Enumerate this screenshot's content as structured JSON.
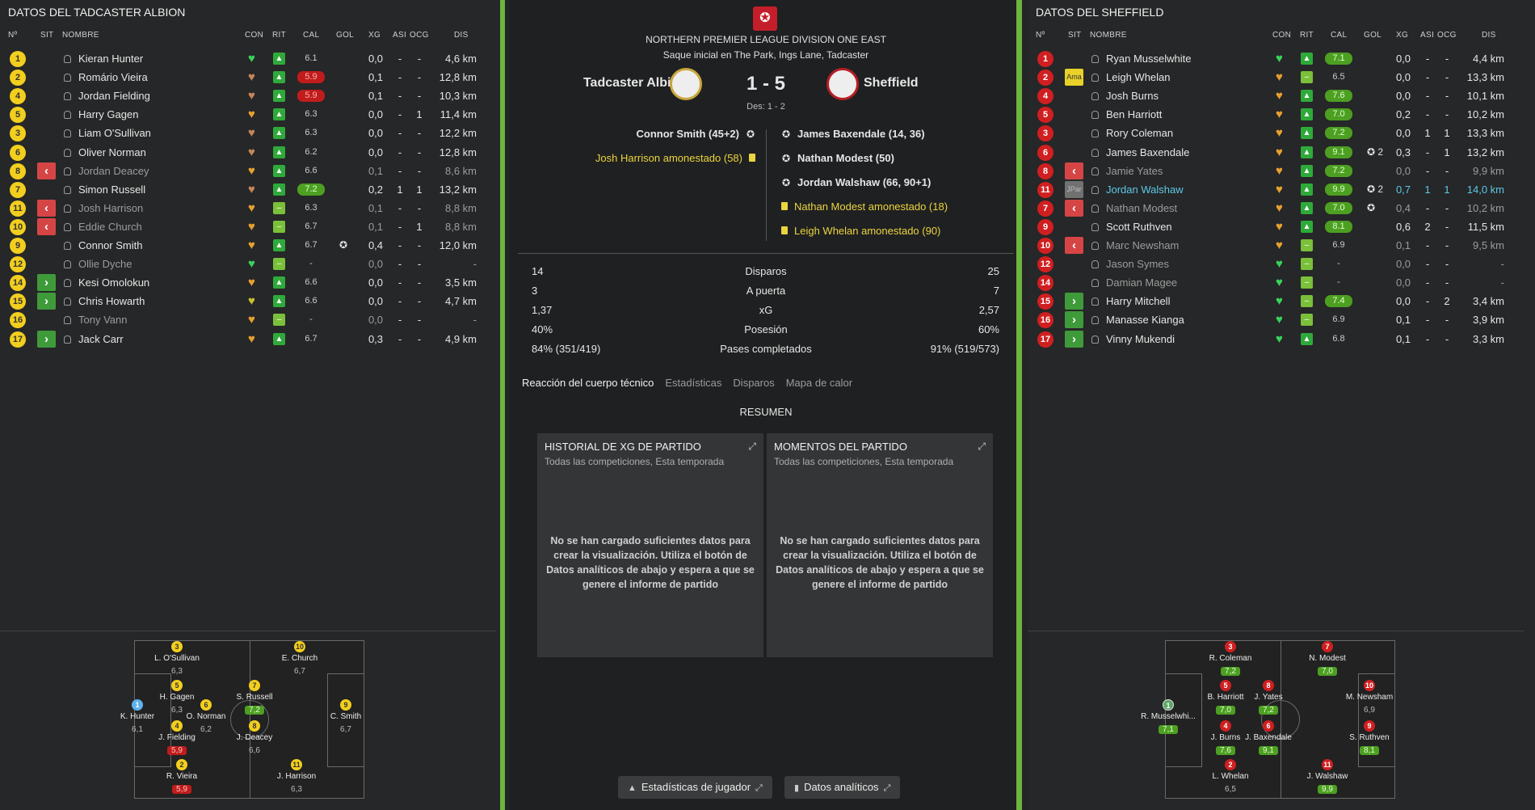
{
  "columns": {
    "num": "Nº",
    "sit": "SIT",
    "nombre": "NOMBRE",
    "con": "CON",
    "rit": "RIT",
    "cal": "CAL",
    "gol": "GOL",
    "xg": "XG",
    "asi": "ASI",
    "ocg": "OCG",
    "dis": "DIS"
  },
  "left": {
    "title": "DATOS DEL TADCASTER ALBION",
    "players": [
      {
        "num": "1",
        "name": "Kieran Hunter",
        "sit": "",
        "cal": "6.1",
        "calc": "",
        "heart": "h-green",
        "rit": "up",
        "goal": "",
        "xg": "0,0",
        "asi": "-",
        "ocg": "-",
        "dis": "4,6 km",
        "dim": false
      },
      {
        "num": "2",
        "name": "Romário Vieira",
        "sit": "",
        "cal": "5.9",
        "calc": "red",
        "heart": "h-brown",
        "rit": "up",
        "goal": "",
        "xg": "0,1",
        "asi": "-",
        "ocg": "-",
        "dis": "12,8 km",
        "dim": false
      },
      {
        "num": "4",
        "name": "Jordan Fielding",
        "sit": "",
        "cal": "5.9",
        "calc": "red",
        "heart": "h-brown",
        "rit": "up",
        "goal": "",
        "xg": "0,1",
        "asi": "-",
        "ocg": "-",
        "dis": "10,3 km",
        "dim": false
      },
      {
        "num": "5",
        "name": "Harry Gagen",
        "sit": "",
        "cal": "6.3",
        "calc": "",
        "heart": "h-orange",
        "rit": "up",
        "goal": "",
        "xg": "0,0",
        "asi": "-",
        "ocg": "1",
        "dis": "11,4 km",
        "dim": false
      },
      {
        "num": "3",
        "name": "Liam O'Sullivan",
        "sit": "",
        "cal": "6.3",
        "calc": "",
        "heart": "h-brown",
        "rit": "up",
        "goal": "",
        "xg": "0,0",
        "asi": "-",
        "ocg": "-",
        "dis": "12,2 km",
        "dim": false
      },
      {
        "num": "6",
        "name": "Oliver Norman",
        "sit": "",
        "cal": "6.2",
        "calc": "",
        "heart": "h-brown",
        "rit": "up",
        "goal": "",
        "xg": "0,0",
        "asi": "-",
        "ocg": "-",
        "dis": "12,8 km",
        "dim": false
      },
      {
        "num": "8",
        "name": "Jordan Deacey",
        "sit": "sub",
        "cal": "6.6",
        "calc": "",
        "heart": "h-orange",
        "rit": "up",
        "goal": "",
        "xg": "0,1",
        "asi": "-",
        "ocg": "-",
        "dis": "8,6 km",
        "dim": true
      },
      {
        "num": "7",
        "name": "Simon Russell",
        "sit": "",
        "cal": "7.2",
        "calc": "green",
        "heart": "h-brown",
        "rit": "up",
        "goal": "",
        "xg": "0,2",
        "asi": "1",
        "ocg": "1",
        "dis": "13,2 km",
        "dim": false
      },
      {
        "num": "11",
        "name": "Josh Harrison",
        "sit": "sub",
        "cal": "6.3",
        "calc": "",
        "heart": "h-orange",
        "rit": "neutral",
        "goal": "",
        "xg": "0,1",
        "asi": "-",
        "ocg": "-",
        "dis": "8,8 km",
        "dim": true
      },
      {
        "num": "10",
        "name": "Eddie Church",
        "sit": "sub",
        "cal": "6.7",
        "calc": "",
        "heart": "h-orange",
        "rit": "neutral",
        "goal": "",
        "xg": "0,1",
        "asi": "-",
        "ocg": "1",
        "dis": "8,8 km",
        "dim": true
      },
      {
        "num": "9",
        "name": "Connor Smith",
        "sit": "",
        "cal": "6.7",
        "calc": "",
        "heart": "h-orange",
        "rit": "up",
        "goal": "✪",
        "xg": "0,4",
        "asi": "-",
        "ocg": "-",
        "dis": "12,0 km",
        "dim": false
      },
      {
        "num": "12",
        "name": "Ollie Dyche",
        "sit": "",
        "cal": "-",
        "calc": "",
        "heart": "h-green",
        "rit": "neutral",
        "goal": "",
        "xg": "0,0",
        "asi": "-",
        "ocg": "-",
        "dis": "-",
        "dim": true
      },
      {
        "num": "14",
        "name": "Kesi Omolokun",
        "sit": "on",
        "cal": "6.6",
        "calc": "",
        "heart": "h-orange",
        "rit": "up",
        "goal": "",
        "xg": "0,0",
        "asi": "-",
        "ocg": "-",
        "dis": "3,5 km",
        "dim": false
      },
      {
        "num": "15",
        "name": "Chris Howarth",
        "sit": "on",
        "cal": "6.6",
        "calc": "",
        "heart": "h-yellowg",
        "rit": "up",
        "goal": "",
        "xg": "0,0",
        "asi": "-",
        "ocg": "-",
        "dis": "4,7 km",
        "dim": false
      },
      {
        "num": "16",
        "name": "Tony Vann",
        "sit": "",
        "cal": "-",
        "calc": "",
        "heart": "h-orange",
        "rit": "neutral",
        "goal": "",
        "xg": "0,0",
        "asi": "-",
        "ocg": "-",
        "dis": "-",
        "dim": true
      },
      {
        "num": "17",
        "name": "Jack Carr",
        "sit": "on",
        "cal": "6.7",
        "calc": "",
        "heart": "h-orange",
        "rit": "up",
        "goal": "",
        "xg": "0,3",
        "asi": "-",
        "ocg": "-",
        "dis": "4,9 km",
        "dim": false
      }
    ]
  },
  "right": {
    "title": "DATOS DEL SHEFFIELD",
    "players": [
      {
        "num": "1",
        "name": "Ryan Musselwhite",
        "sit": "",
        "cal": "7.1",
        "calc": "green",
        "heart": "h-green",
        "rit": "up",
        "goal": "",
        "xg": "0,0",
        "asi": "-",
        "ocg": "-",
        "dis": "4,4 km",
        "dim": false
      },
      {
        "num": "2",
        "name": "Leigh Whelan",
        "sit": "ama",
        "sitlabel": "Ama",
        "cal": "6.5",
        "calc": "",
        "heart": "h-orange",
        "rit": "neutral",
        "goal": "",
        "xg": "0,0",
        "asi": "-",
        "ocg": "-",
        "dis": "13,3 km",
        "dim": false
      },
      {
        "num": "4",
        "name": "Josh Burns",
        "sit": "",
        "cal": "7.6",
        "calc": "green",
        "heart": "h-orange",
        "rit": "up",
        "goal": "",
        "xg": "0,0",
        "asi": "-",
        "ocg": "-",
        "dis": "10,1 km",
        "dim": false
      },
      {
        "num": "5",
        "name": "Ben Harriott",
        "sit": "",
        "cal": "7.0",
        "calc": "green",
        "heart": "h-orange",
        "rit": "up",
        "goal": "",
        "xg": "0,2",
        "asi": "-",
        "ocg": "-",
        "dis": "10,2 km",
        "dim": false
      },
      {
        "num": "3",
        "name": "Rory Coleman",
        "sit": "",
        "cal": "7.2",
        "calc": "green",
        "heart": "h-orange",
        "rit": "up",
        "goal": "",
        "xg": "0,0",
        "asi": "1",
        "ocg": "1",
        "dis": "13,3 km",
        "dim": false
      },
      {
        "num": "6",
        "name": "James Baxendale",
        "sit": "",
        "cal": "9.1",
        "calc": "green",
        "heart": "h-orange",
        "rit": "up",
        "goal": "✪ 2",
        "xg": "0,3",
        "asi": "-",
        "ocg": "1",
        "dis": "13,2 km",
        "dim": false
      },
      {
        "num": "8",
        "name": "Jamie Yates",
        "sit": "sub",
        "cal": "7.2",
        "calc": "green",
        "heart": "h-orange",
        "rit": "up",
        "goal": "",
        "xg": "0,0",
        "asi": "-",
        "ocg": "-",
        "dis": "9,9 km",
        "dim": true
      },
      {
        "num": "11",
        "name": "Jordan Walshaw",
        "sit": "jpar",
        "sitlabel": "JPar",
        "cal": "9.9",
        "calc": "green",
        "heart": "h-orange",
        "rit": "up",
        "goal": "✪ 2",
        "xg": "0,7",
        "asi": "1",
        "ocg": "1",
        "dis": "14,0 km",
        "dim": false,
        "hl": true
      },
      {
        "num": "7",
        "name": "Nathan Modest",
        "sit": "sub",
        "cal": "7.0",
        "calc": "green",
        "heart": "h-orange",
        "rit": "up",
        "goal": "✪",
        "xg": "0,4",
        "asi": "-",
        "ocg": "-",
        "dis": "10,2 km",
        "dim": true
      },
      {
        "num": "9",
        "name": "Scott Ruthven",
        "sit": "",
        "cal": "8.1",
        "calc": "green",
        "heart": "h-orange",
        "rit": "up",
        "goal": "",
        "xg": "0,6",
        "asi": "2",
        "ocg": "-",
        "dis": "11,5 km",
        "dim": false
      },
      {
        "num": "10",
        "name": "Marc Newsham",
        "sit": "sub",
        "cal": "6.9",
        "calc": "",
        "heart": "h-orange",
        "rit": "neutral",
        "goal": "",
        "xg": "0,1",
        "asi": "-",
        "ocg": "-",
        "dis": "9,5 km",
        "dim": true
      },
      {
        "num": "12",
        "name": "Jason Symes",
        "sit": "",
        "cal": "-",
        "calc": "",
        "heart": "h-green",
        "rit": "neutral",
        "goal": "",
        "xg": "0,0",
        "asi": "-",
        "ocg": "-",
        "dis": "-",
        "dim": true
      },
      {
        "num": "14",
        "name": "Damian Magee",
        "sit": "",
        "cal": "-",
        "calc": "",
        "heart": "h-green",
        "rit": "neutral",
        "goal": "",
        "xg": "0,0",
        "asi": "-",
        "ocg": "-",
        "dis": "-",
        "dim": true
      },
      {
        "num": "15",
        "name": "Harry Mitchell",
        "sit": "on",
        "cal": "7.4",
        "calc": "green",
        "heart": "h-green",
        "rit": "neutral",
        "goal": "",
        "xg": "0,0",
        "asi": "-",
        "ocg": "2",
        "dis": "3,4 km",
        "dim": false
      },
      {
        "num": "16",
        "name": "Manasse Kianga",
        "sit": "on",
        "cal": "6.9",
        "calc": "",
        "heart": "h-green",
        "rit": "neutral",
        "goal": "",
        "xg": "0,1",
        "asi": "-",
        "ocg": "-",
        "dis": "3,9 km",
        "dim": false
      },
      {
        "num": "17",
        "name": "Vinny Mukendi",
        "sit": "on",
        "cal": "6.8",
        "calc": "",
        "heart": "h-green",
        "rit": "up",
        "goal": "",
        "xg": "0,1",
        "asi": "-",
        "ocg": "-",
        "dis": "3,3 km",
        "dim": false
      }
    ]
  },
  "center": {
    "league": "NORTHERN PREMIER LEAGUE DIVISION ONE EAST",
    "venue": "Saque inicial en The Park, Ings Lane, Tadcaster",
    "home": "Tadcaster Albion",
    "away": "Sheffield",
    "score": "1 - 5",
    "halftime": "Des: 1 - 2",
    "home_events": [
      {
        "text": "Connor Smith (45+2)",
        "type": "goal"
      },
      {
        "text": "Josh Harrison amonestado (58)",
        "type": "card"
      }
    ],
    "away_events": [
      {
        "text": "James Baxendale (14, 36)",
        "type": "goal"
      },
      {
        "text": "Nathan Modest (50)",
        "type": "goal"
      },
      {
        "text": "Jordan Walshaw (66, 90+1)",
        "type": "goal"
      },
      {
        "text": "Nathan Modest amonestado (18)",
        "type": "card"
      },
      {
        "text": "Leigh Whelan amonestado (90)",
        "type": "card"
      }
    ],
    "stats": [
      {
        "label": "Disparos",
        "home": "14",
        "away": "25"
      },
      {
        "label": "A puerta",
        "home": "3",
        "away": "7"
      },
      {
        "label": "xG",
        "home": "1,37",
        "away": "2,57"
      },
      {
        "label": "Posesión",
        "home": "40%",
        "away": "60%"
      },
      {
        "label": "Pases completados",
        "home": "84% (351/419)",
        "away": "91% (519/573)"
      }
    ],
    "tabs": [
      "Reacción del cuerpo técnico",
      "Estadísticas",
      "Disparos",
      "Mapa de calor"
    ],
    "resumen": "RESUMEN",
    "card1_title": "HISTORIAL DE XG DE PARTIDO",
    "card2_title": "MOMENTOS DEL PARTIDO",
    "card_sub": "Todas las competiciones, Esta temporada",
    "card_msg": "No se han cargado suficientes datos para crear la visualización. Utiliza el botón de Datos analíticos de abajo y espera a que se genere el informe de partido",
    "btn_stats": "Estadísticas de jugador",
    "btn_data": "Datos analíticos"
  },
  "home_pitch": [
    {
      "num": "3",
      "name": "L. O'Sullivan",
      "val": "6,3",
      "c": "y",
      "vc": ""
    },
    {
      "num": "10",
      "name": "E. Church",
      "val": "6,7",
      "c": "y",
      "vc": ""
    },
    {
      "num": "5",
      "name": "H. Gagen",
      "val": "6,3",
      "c": "y",
      "vc": ""
    },
    {
      "num": "7",
      "name": "S. Russell",
      "val": "7,2",
      "c": "y",
      "vc": "green"
    },
    {
      "num": "1",
      "name": "K. Hunter",
      "val": "6,1",
      "c": "b",
      "vc": ""
    },
    {
      "num": "6",
      "name": "O. Norman",
      "val": "6,2",
      "c": "y",
      "vc": ""
    },
    {
      "num": "9",
      "name": "C. Smith",
      "val": "6,7",
      "c": "y",
      "vc": ""
    },
    {
      "num": "4",
      "name": "J. Fielding",
      "val": "5,9",
      "c": "y",
      "vc": "red"
    },
    {
      "num": "8",
      "name": "J. Deacey",
      "val": "6,6",
      "c": "y",
      "vc": ""
    },
    {
      "num": "2",
      "name": "R. Vieira",
      "val": "5,9",
      "c": "y",
      "vc": "red"
    },
    {
      "num": "11",
      "name": "J. Harrison",
      "val": "6,3",
      "c": "y",
      "vc": ""
    }
  ],
  "away_pitch": [
    {
      "num": "3",
      "name": "R. Coleman",
      "val": "7,2",
      "c": "r",
      "vc": "green"
    },
    {
      "num": "7",
      "name": "N. Modest",
      "val": "7,0",
      "c": "r",
      "vc": "green"
    },
    {
      "num": "5",
      "name": "B. Harriott",
      "val": "7,0",
      "c": "r",
      "vc": "green"
    },
    {
      "num": "8",
      "name": "J. Yates",
      "val": "7,2",
      "c": "r",
      "vc": "green"
    },
    {
      "num": "10",
      "name": "M. Newsham",
      "val": "6,9",
      "c": "r",
      "vc": ""
    },
    {
      "num": "1",
      "name": "R. Musselwhi...",
      "val": "7,1",
      "c": "g",
      "vc": "green"
    },
    {
      "num": "4",
      "name": "J. Burns",
      "val": "7,6",
      "c": "r",
      "vc": "green"
    },
    {
      "num": "6",
      "name": "J. Baxendale",
      "val": "9,1",
      "c": "r",
      "vc": "green"
    },
    {
      "num": "9",
      "name": "S. Ruthven",
      "val": "8,1",
      "c": "r",
      "vc": "green"
    },
    {
      "num": "2",
      "name": "L. Whelan",
      "val": "6,5",
      "c": "r",
      "vc": ""
    },
    {
      "num": "11",
      "name": "J. Walshaw",
      "val": "9,9",
      "c": "r",
      "vc": "green"
    }
  ]
}
